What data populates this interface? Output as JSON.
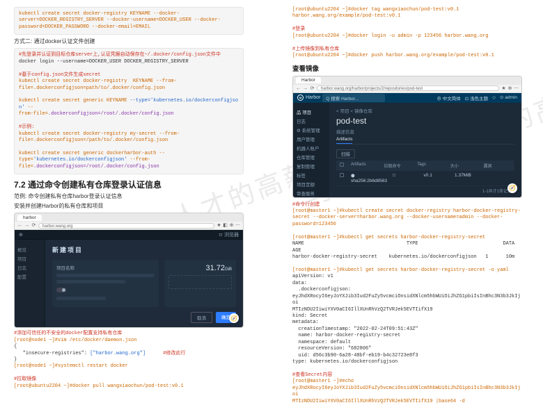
{
  "watermark": "马哥教育 IT人才的高薪职业学院",
  "left": {
    "codeblock1": "kubectl create secret docker-registry KEYNAME --docker-\nserver=DOCKER_REGISTRY_SERVER --docker-username=DOCKER_USER --docker-\npassword=DOCKER_PASSWORD --docker-email=EMAIL",
    "method2_title": "方式二: 通过docker认证文件创建",
    "codeblock2_c1": "#先登录并认证到目标仓库server上,认证凭据自动保存在~/.docker/config.json文件中",
    "codeblock2_l1": "docker login --username=DOCKER_USER DOCKER_REGISTRY_SERVER",
    "codeblock2_c2": "#基于config.json文件生成secret",
    "codeblock2_l2": "kubectl create secret docker-registry  KEYNAME --from-\nfile=.dockerconfigjson=path/to/.docker/config.json",
    "codeblock2_l3a": "kubectl create secret generic KEYNAME ",
    "codeblock2_type": "--type='kubernetes.io/dockerconfigjson'",
    "codeblock2_l3b": " --\nfrom-file=",
    "codeblock2_l3c": ".dockerconfigjson=/root/.docker/config.json",
    "codeblock2_c3": "#示例:",
    "codeblock2_l4": "kubectl create secret docker-registry my-secret --from-\nfile=.dockerconfigjson=/path/to/.docker/config.json",
    "codeblock2_l5a": "kubectl create secret generic dockerharbor-auth --\ntype=",
    "codeblock2_l5b": "'kubernetes.io/dockerconfigjson'",
    "codeblock2_l5c": " --from-\nfile=",
    "codeblock2_l5d": ".dockerconfigjson=/root/.docker/config.json",
    "h2": "7.2 通过命令创建私有仓库登录认证信息",
    "example_label": "范例: 命令创建私有仓库harbor登录认证信息",
    "p_install": "安装并创建Harbor的私有仓库和项目",
    "browser1": {
      "tab": "harbor",
      "url": "harbor.wang.org",
      "topbar_left": "⊕",
      "topbar_right": "ㅁ 浏览器",
      "side": [
        "概览",
        "项目",
        "日志",
        "配置"
      ],
      "title": "新建项目",
      "card_left_label": "项目名称",
      "bignum": "31.72",
      "bignum_unit": "GiB",
      "btn_cancel": "取消",
      "btn_ok": "确定",
      "float": "🧭"
    },
    "code3_c1": "#添加可信任的不安全的docker配置支持私有仓库",
    "code3_l1": "[root@node1 ~]#vim /etc/docker/daemon.json",
    "code3_l2": "{",
    "code3_l3a": "   \"insecure-registries\": ",
    "code3_l3b": "[\"harbor.wang.org\"]",
    "code3_l3c": "      #修改此行",
    "code3_l4": "}",
    "code3_l5": "[root@node1 ~]#systemctl restart docker",
    "code3_c2": "#拉取镜像",
    "code3_l6": "[root@ubuntu2204 ~]#docker pull wangxiaochun/pod-test:v0.1"
  },
  "right": {
    "code1_l1": "[root@ubuntu2204 ~]#docker tag wangxiaochun/pod-test:v0.1 \nharbor.wang.org/example/pod-test:v0.1",
    "code1_c1": "#登录",
    "code1_l2": "[root@ubuntu2204 ~]#docker login -u admin -p 123456 harbor.wang.org",
    "code1_c2": "#上传镜像到私有仓库",
    "code1_l3": "[root@ubuntu2204 ~]#docker push harbor.wang.org/example/pod-test:v0.1",
    "h_view": "查看镜像",
    "browser2": {
      "tab": "Harbor",
      "url": "harbor.wang.org/harbor/projects/2/repositories/pod-test",
      "brand": "Harbor",
      "search_ph": "Q 搜索 Harbor...",
      "toplinks": [
        "⊕ 中文简体",
        "⊡ 浅色主题",
        "◇",
        "⊙ admin"
      ],
      "side": [
        "品 项目",
        "日志",
        "⚙ 系统管理",
        "用户管理",
        "机器人账户",
        "仓库管理",
        "复制管理",
        "标签",
        "项目定额",
        "审查服务"
      ],
      "crumb": "< 项目 < 镜像仓库",
      "title": "pod-test",
      "desc": "描述信息",
      "tabs": [
        "Artifacts"
      ],
      "scan": "扫描",
      "th": [
        "Artifacts",
        "拉取命令",
        "Tags",
        "大小",
        "漏洞"
      ],
      "row": [
        "⬢ sha256:2b6d8563",
        "□",
        "v0.1",
        "1.37MiB",
        ""
      ],
      "foot": "1-1共计1条记录",
      "float": "🧭"
    },
    "code2_c1": "#命令行创建",
    "code2_l1": "[root@master1 ~]#kubectl create secret docker-registry harbor-docker-registry-\nsecret --docker-server=harbor.wang.org --docker-username=admin --docker-\npassword=123456",
    "code2_l2": "[root@master1 ~]#kubectl get secrets harbor-docker-registry-secret",
    "code2_t1": "NAME                                   TYPE                             DATA   AGE\nharbor-docker-registry-secret    kubernetes.io/dockerconfigjson   1      10m",
    "code2_l3": "[root@master1 ~]#kubectl get secrets harbor-docker-registry-secret -o yaml",
    "code2_y": "apiVersion: v1\ndata:\n  .dockerconfigjson:\neyJhdXRocyI6eyJoYXJib3Iud2FuZy5vcmciOnsidXNlcm5hbWUiOiJhZG1pbiIsInBhc3N3b3JkIjoi\nMTIzNDU2IiwiYXV0aCI6IllXUnRhVzQ2TVRJek5EVTIifX19\nkind: Secret\nmetadata:\n  creationTimestamp: \"2022-02-24T09:51:43Z\"\n  name: harbor-docker-registry-secret\n  namespace: default\n  resourceVersion: \"682806\"\n  uid: d56c3b90-6a28-48bf-eb19-b4c32723e8f3\ntype: kubernetes.io/dockerconfigjson",
    "code2_c2": "#查看Secret内容",
    "code2_l4": "[root@master1 ~]#echo \neyJhdXRocyI6eyJoYXJib3Iud2FuZy5vcmciOnsidXNlcm5hbWUiOiJhZG1pbiIsInBhc3N3b3JkIjoi\nMTIzNDU2IiwiYXV0aCI6IllXUnRhVzQ2TVRJek5EVTIifX19 |base64 -d"
  }
}
